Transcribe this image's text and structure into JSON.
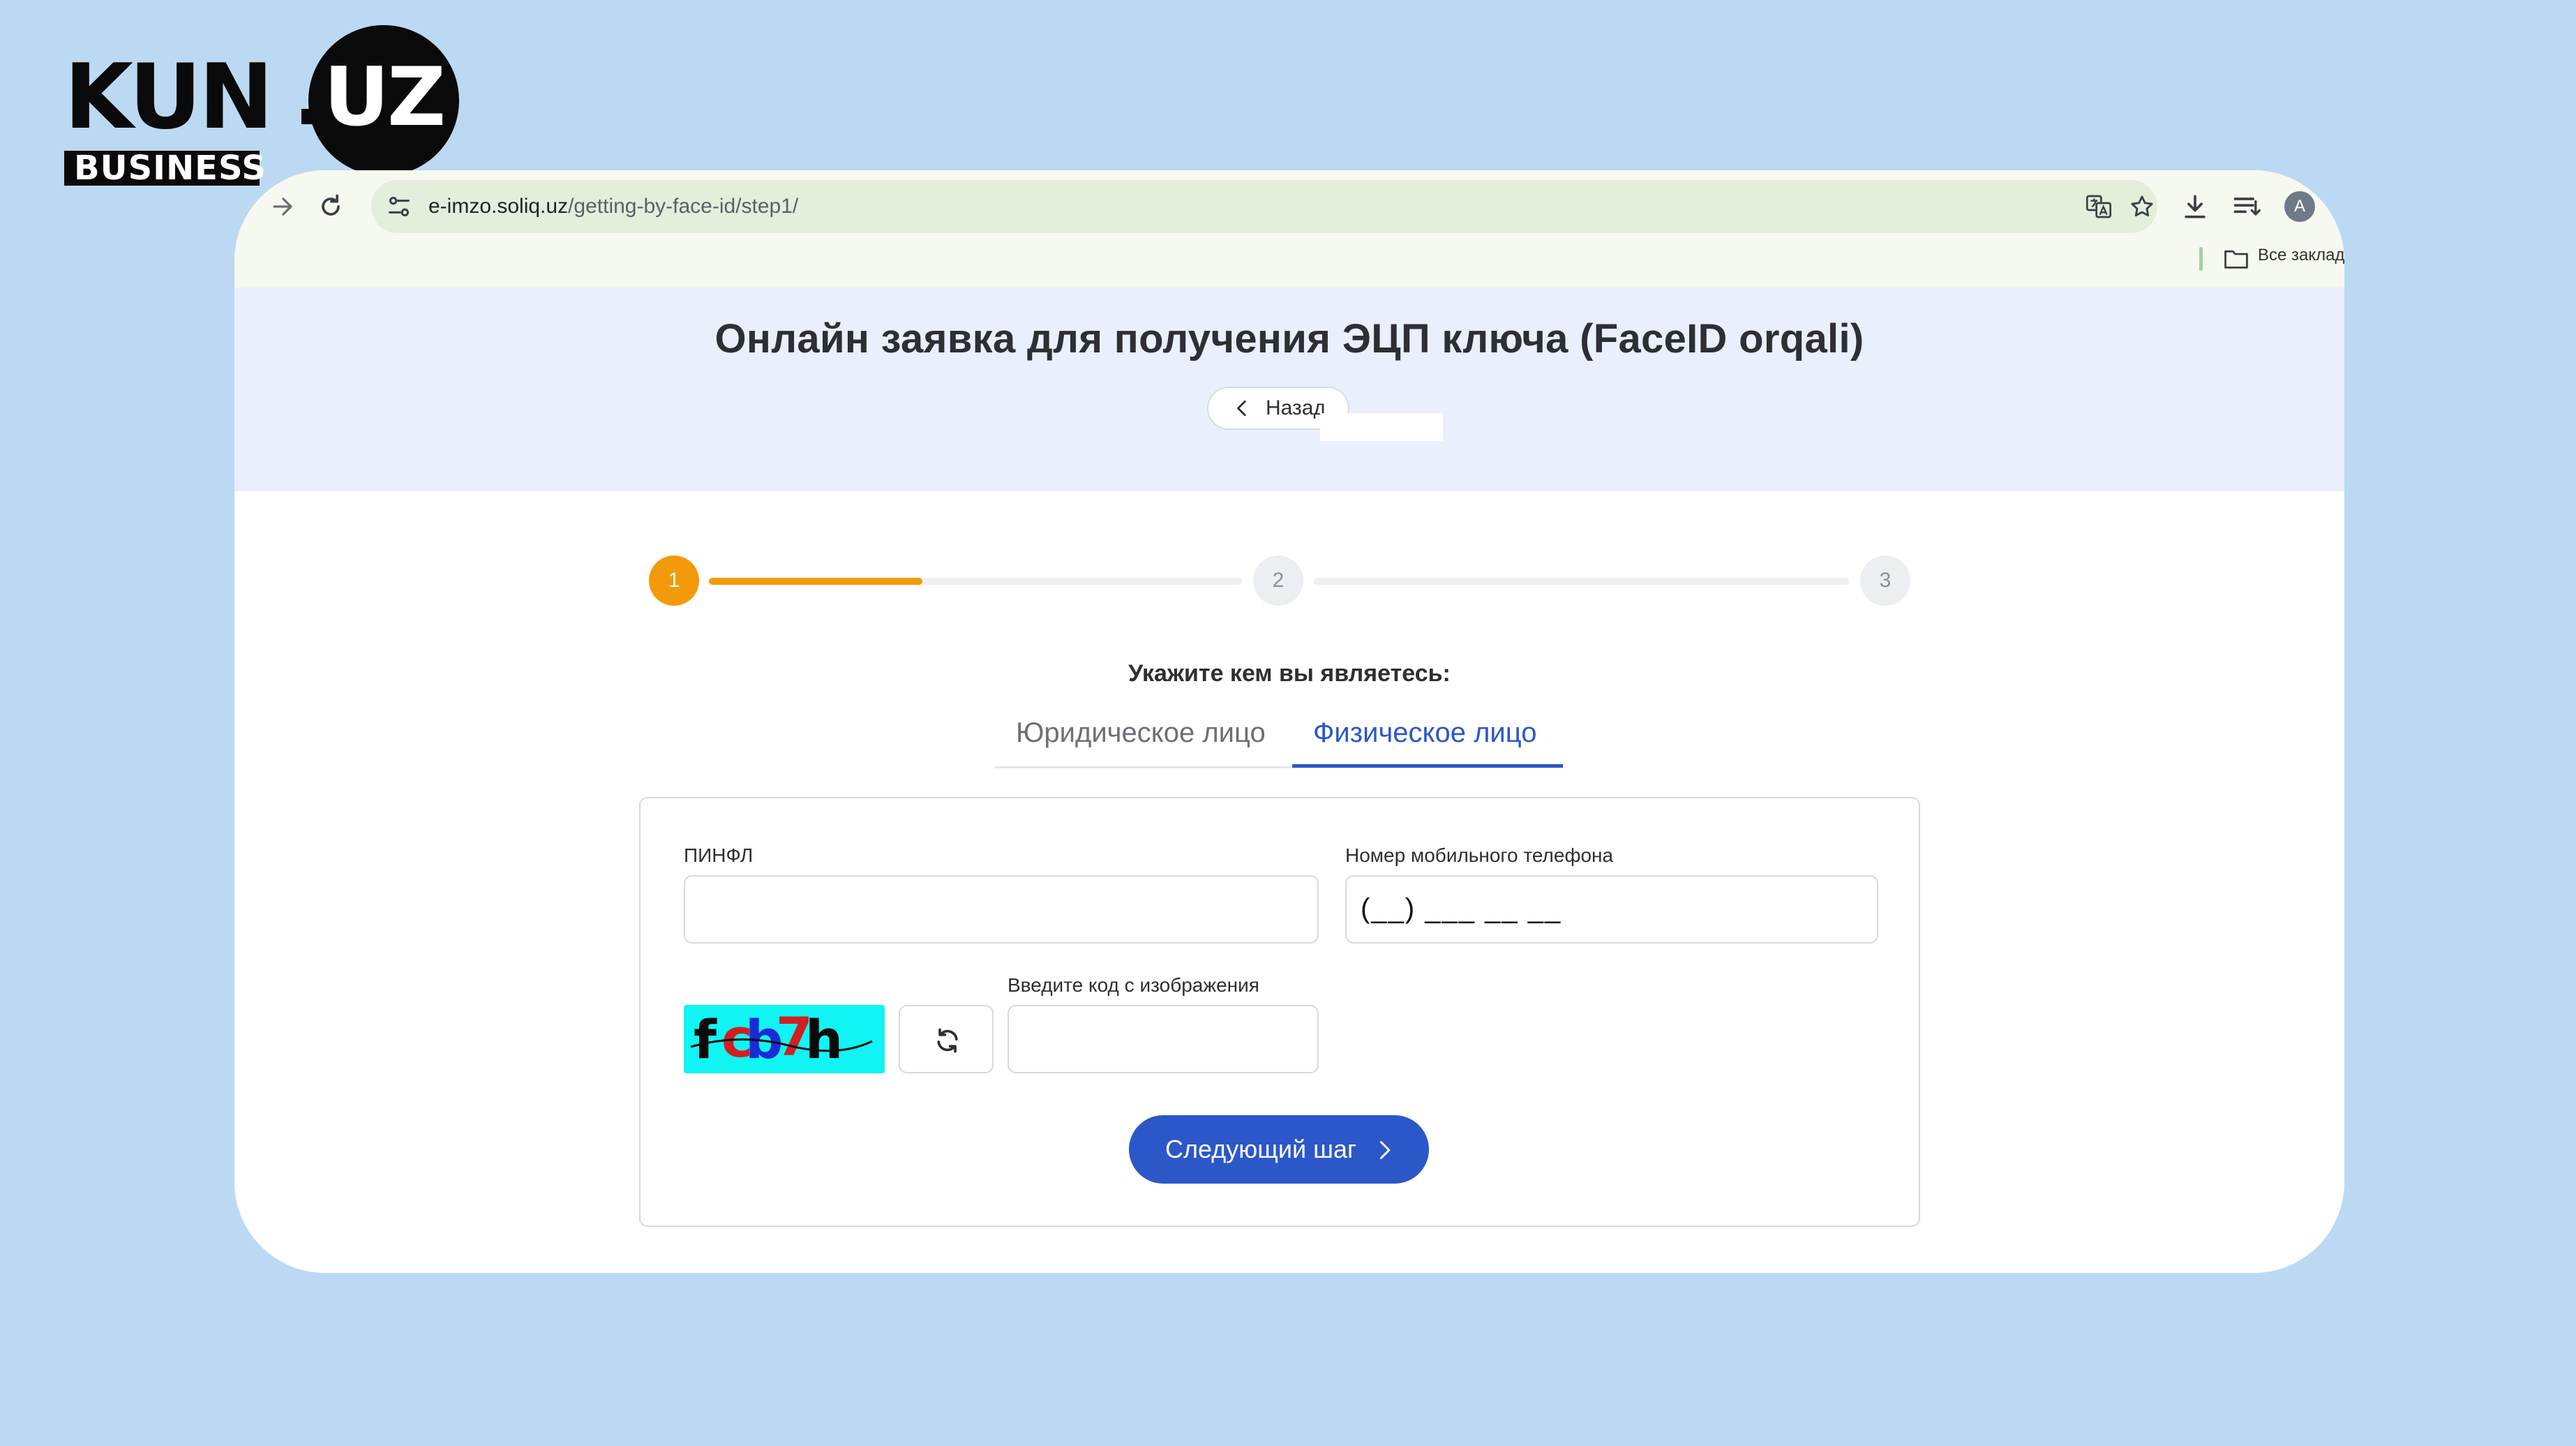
{
  "brand": {
    "logo_main": "KUN",
    "logo_suffix": "UZ",
    "logo_sub": "BUSINESS"
  },
  "browser": {
    "url_domain": "e-imzo.soliq.uz",
    "url_path": "/getting-by-face-id/step1/",
    "avatar_letter": "A",
    "bookmarks_label": "Все заклад",
    "icons": [
      "forward-icon",
      "reload-icon",
      "site-settings-icon",
      "translate-icon",
      "star-icon",
      "download-icon",
      "reading-list-icon",
      "folder-icon"
    ]
  },
  "header": {
    "title": "Онлайн заявка для получения ЭЦП ключа (FaceID orqali)",
    "back_label": "Назад"
  },
  "stepper": {
    "steps": [
      "1",
      "2",
      "3"
    ],
    "current": 1,
    "progress_fraction": 0.4,
    "active_color": "#f39a0b"
  },
  "selector": {
    "prompt": "Укажите кем вы являетесь:",
    "tabs": [
      "Юридическое лицо",
      "Физическое лицо"
    ],
    "active_tab": "Физическое лицо",
    "active_color": "#2b57c9"
  },
  "form": {
    "pinfl_label": "ПИНФЛ",
    "pinfl_value": "",
    "phone_label": "Номер мобильного телефона",
    "phone_mask": "(__) ___ __ __",
    "captcha_text": "fcb7h",
    "captcha_label": "Введите код с изображения",
    "captcha_value": "",
    "next_label": "Следующий шаг"
  }
}
